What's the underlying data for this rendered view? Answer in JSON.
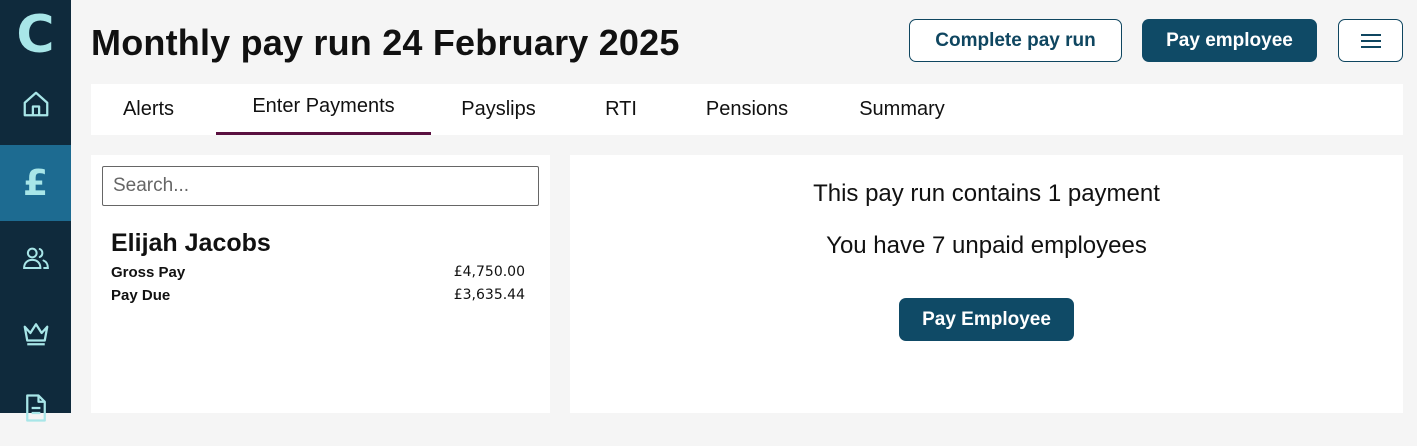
{
  "brand": {
    "logo_letter": "C",
    "accent": "#a8e6e8",
    "sidebar_bg": "#0f2a3c",
    "sidebar_active": "#1d6b91"
  },
  "sidebar": {
    "items": [
      {
        "icon": "home-icon",
        "active": false
      },
      {
        "icon": "pound-icon",
        "glyph": "£",
        "active": true
      },
      {
        "icon": "people-icon",
        "active": false
      },
      {
        "icon": "crown-icon",
        "active": false
      },
      {
        "icon": "document-icon",
        "active": false
      }
    ]
  },
  "header": {
    "title": "Monthly pay run 24 February 2025",
    "complete_label": "Complete pay run",
    "pay_label": "Pay employee",
    "menu_icon": "hamburger-icon"
  },
  "tabs": [
    {
      "label": "Alerts",
      "active": false
    },
    {
      "label": "Enter Payments",
      "active": true
    },
    {
      "label": "Payslips",
      "active": false
    },
    {
      "label": "RTI",
      "active": false
    },
    {
      "label": "Pensions",
      "active": false
    },
    {
      "label": "Summary",
      "active": false
    }
  ],
  "search": {
    "placeholder": "Search...",
    "value": ""
  },
  "employee": {
    "name": "Elijah Jacobs",
    "gross_label": "Gross Pay",
    "gross_value": "£4,750.00",
    "due_label": "Pay Due",
    "due_value": "£3,635.44"
  },
  "summary": {
    "payments_text": "This pay run contains 1 payment",
    "unpaid_text": "You have 7 unpaid employees",
    "pay_button_label": "Pay Employee"
  }
}
